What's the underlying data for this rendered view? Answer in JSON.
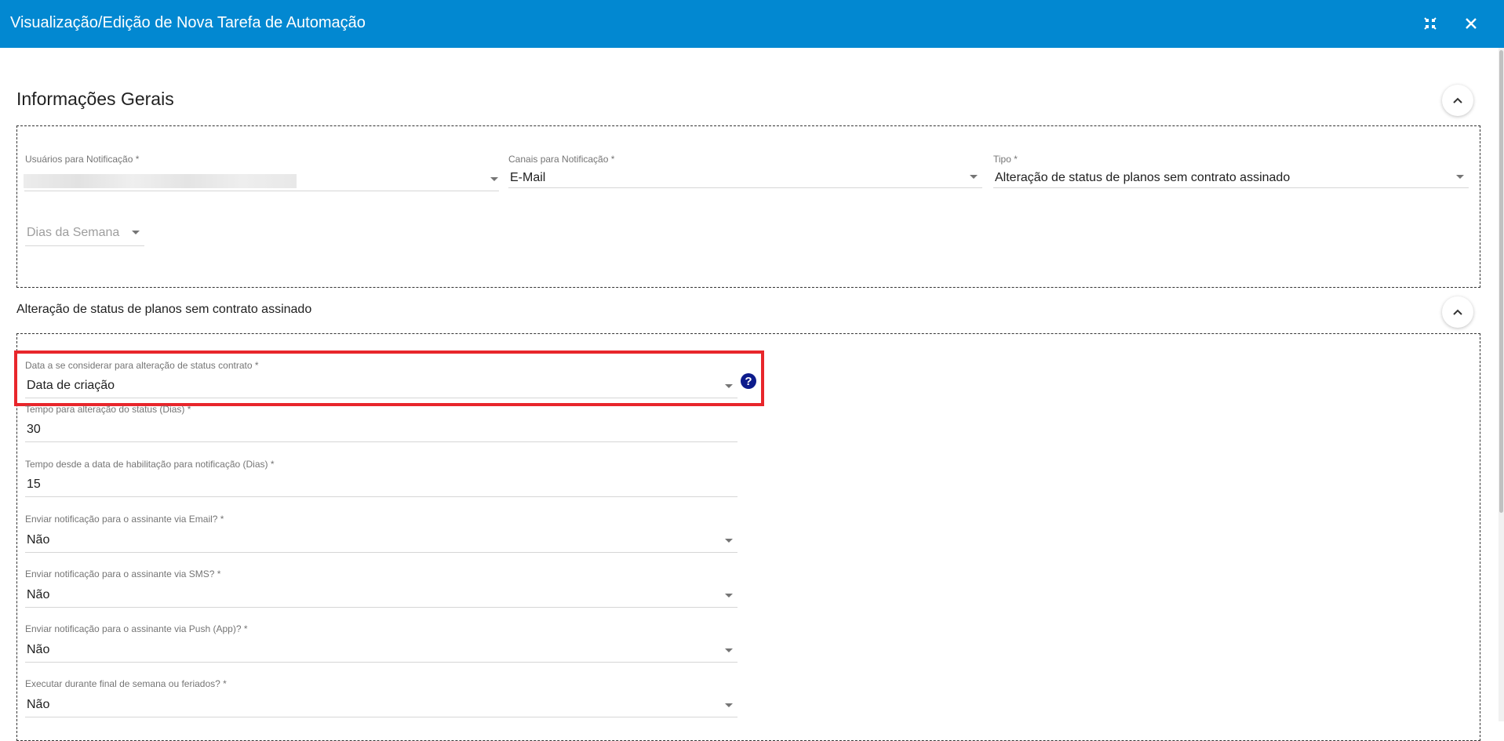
{
  "window": {
    "title": "Visualização/Edição de Nova Tarefa de Automação"
  },
  "icons": {
    "minimize": "collapse-arrows-icon",
    "close": "close-icon",
    "collapse": "chevron-up-icon",
    "help": "help-circle-icon"
  },
  "colors": {
    "header": "#0288d1",
    "highlight": "#e8262b",
    "help_icon": "#0d1b8c"
  },
  "general": {
    "title": "Informações Gerais",
    "usuarios_label": "Usuários para Notificação *",
    "canais_label": "Canais para Notificação *",
    "canais_value": "E-Mail",
    "tipo_label": "Tipo *",
    "tipo_value": "Alteração de status de planos sem contrato assinado",
    "dias_placeholder": "Dias da Semana"
  },
  "status_section": {
    "title": "Alteração de status de planos sem contrato assinado",
    "fields": [
      {
        "label": "Data a se considerar para alteração de status contrato *",
        "value": "Data de criação"
      },
      {
        "label": "Tempo para alteração do status (Dias) *",
        "value": "30"
      },
      {
        "label": "Tempo desde a data de habilitação para notificação (Dias) *",
        "value": "15"
      },
      {
        "label": "Enviar notificação para o assinante via Email? *",
        "value": "Não"
      },
      {
        "label": "Enviar notificação para o assinante via SMS? *",
        "value": "Não"
      },
      {
        "label": "Enviar notificação para o assinante via Push (App)? *",
        "value": "Não"
      },
      {
        "label": "Executar durante final de semana ou feriados? *",
        "value": "Não"
      }
    ]
  }
}
